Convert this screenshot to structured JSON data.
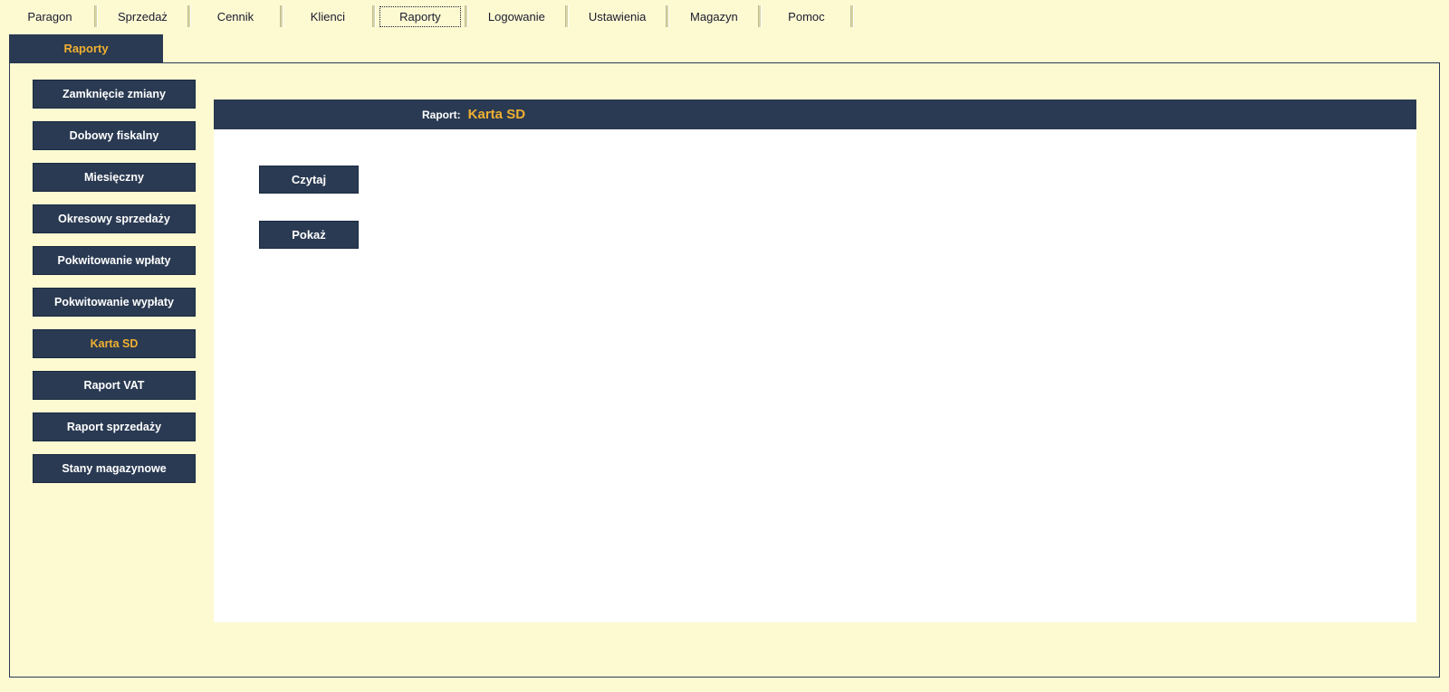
{
  "topMenu": {
    "items": [
      {
        "label": "Paragon"
      },
      {
        "label": "Sprzedaż"
      },
      {
        "label": "Cennik"
      },
      {
        "label": "Klienci"
      },
      {
        "label": "Raporty"
      },
      {
        "label": "Logowanie"
      },
      {
        "label": "Ustawienia"
      },
      {
        "label": "Magazyn"
      },
      {
        "label": "Pomoc"
      }
    ],
    "activeIndex": 4
  },
  "tab": {
    "title": "Raporty"
  },
  "sidebar": {
    "items": [
      {
        "label": "Zamknięcie zmiany"
      },
      {
        "label": "Dobowy fiskalny"
      },
      {
        "label": "Miesięczny"
      },
      {
        "label": "Okresowy sprzedaży"
      },
      {
        "label": "Pokwitowanie wpłaty"
      },
      {
        "label": "Pokwitowanie wypłaty"
      },
      {
        "label": "Karta SD"
      },
      {
        "label": "Raport VAT"
      },
      {
        "label": "Raport sprzedaży"
      },
      {
        "label": "Stany magazynowe"
      }
    ],
    "activeIndex": 6
  },
  "reportHeader": {
    "label": "Raport:",
    "name": "Karta SD"
  },
  "actions": {
    "read": "Czytaj",
    "show": "Pokaż"
  }
}
